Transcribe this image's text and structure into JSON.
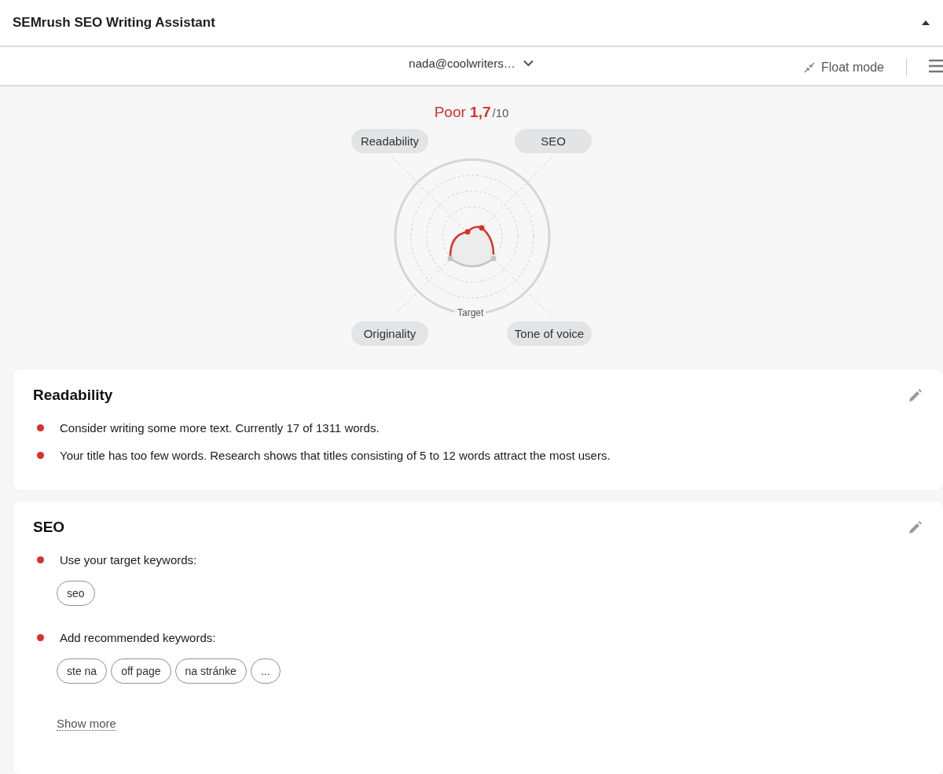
{
  "window": {
    "title": "SEMrush SEO Writing Assistant"
  },
  "toolbar": {
    "account": "nada@coolwriters…",
    "float_mode": "Float mode"
  },
  "score": {
    "rating": "Poor",
    "value": "1,7",
    "max": "/10"
  },
  "radar": {
    "labels": [
      "Readability",
      "SEO",
      "Originality",
      "Tone of voice"
    ],
    "target_label": "Target"
  },
  "cards": [
    {
      "title": "Readability",
      "items": [
        {
          "text": "Consider writing some more text. Currently 17 of 1311 words."
        },
        {
          "text": "Your title has too few words. Research shows that titles consisting of 5 to 12 words attract the most users."
        }
      ]
    },
    {
      "title": "SEO",
      "items": [
        {
          "text": "Use your target keywords:",
          "keywords": [
            "seo"
          ]
        },
        {
          "text": "Add recommended keywords:",
          "keywords": [
            "ste na",
            "off page",
            "na stránke",
            "..."
          ]
        }
      ],
      "link": "Show more"
    }
  ]
}
